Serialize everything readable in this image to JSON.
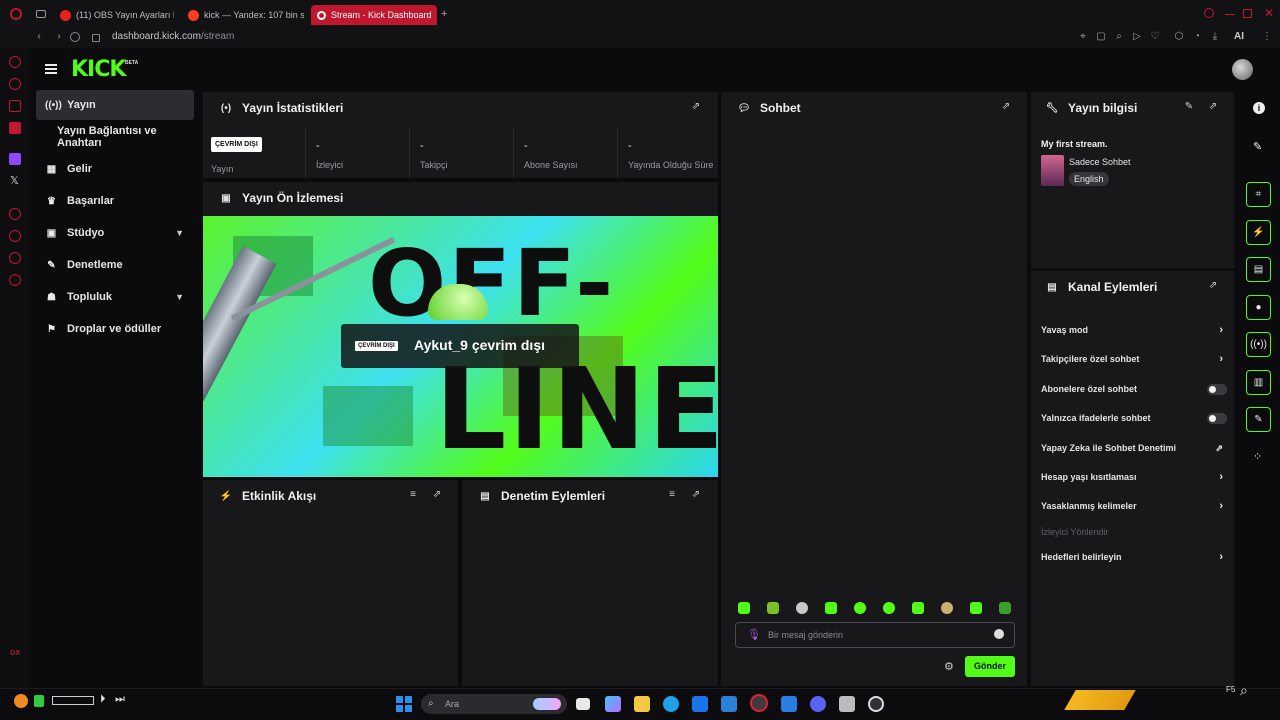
{
  "browser": {
    "tabs": [
      {
        "label": "(11) OBS Yayın Ayarları Nas",
        "color": "#e62117",
        "active": false
      },
      {
        "label": "kick — Yandex: 107 bin so",
        "color": "#fc3f1d",
        "active": false
      },
      {
        "label": "Stream - Kick Dashboard",
        "color": "#ff4d5e",
        "active": true
      }
    ],
    "url_domain": "dashboard.kick.com",
    "url_path": "/stream",
    "ai_label": "AI"
  },
  "header": {
    "logo": "KICK",
    "beta": "BETA"
  },
  "sidebar": {
    "items": [
      {
        "label": "Yayın",
        "icon": "broadcast-icon",
        "active": true
      },
      {
        "label": "Yayın Bağlantısı ve Anahtarı",
        "icon": "",
        "active": false
      },
      {
        "label": "Gelir",
        "icon": "revenue-icon",
        "active": false
      },
      {
        "label": "Başarılar",
        "icon": "trophy-icon",
        "active": false
      },
      {
        "label": "Stüdyo",
        "icon": "studio-icon",
        "active": false,
        "expandable": true
      },
      {
        "label": "Denetleme",
        "icon": "wrench-icon",
        "active": false
      },
      {
        "label": "Topluluk",
        "icon": "community-icon",
        "active": false,
        "expandable": true
      },
      {
        "label": "Droplar ve ödüller",
        "icon": "drops-icon",
        "active": false
      }
    ]
  },
  "stats": {
    "title": "Yayın İstatistikleri",
    "offline_badge": "ÇEVRİM DIŞI",
    "stream_label": "Yayın",
    "items": [
      {
        "value": "-",
        "label": "İzleyici"
      },
      {
        "value": "-",
        "label": "Takipçi"
      },
      {
        "value": "-",
        "label": "Abone Sayısı"
      },
      {
        "value": "-",
        "label": "Yayında Olduğu Süre"
      }
    ]
  },
  "preview": {
    "title": "Yayın Ön İzlemesi",
    "badge": "ÇEVRİM DIŞI",
    "message": "Aykut_9 çevrim dışı",
    "art_text_top": "OFF-",
    "art_text_bottom": "LINE"
  },
  "activity": {
    "title": "Etkinlik Akışı"
  },
  "mod_actions": {
    "title": "Denetim Eylemleri"
  },
  "chat": {
    "title": "Sohbet",
    "placeholder": "Bir mesaj gönderin",
    "send_label": "Gönder"
  },
  "stream_info": {
    "title": "Yayın bilgisi",
    "stream_title": "My first stream.",
    "category": "Sadece Sohbet",
    "language": "English"
  },
  "channel_actions": {
    "title": "Kanal Eylemleri",
    "items": [
      {
        "label": "Yavaş mod",
        "control": "arrow"
      },
      {
        "label": "Takipçilere özel sohbet",
        "control": "arrow"
      },
      {
        "label": "Abonelere özel sohbet",
        "control": "toggle"
      },
      {
        "label": "Yalnızca ifadelerle sohbet",
        "control": "toggle"
      },
      {
        "label": "Yapay Zeka ile Sohbet Denetimi",
        "control": "external"
      },
      {
        "label": "Hesap yaşı kısıtlaması",
        "control": "arrow"
      },
      {
        "label": "Yasaklanmış kelimeler",
        "control": "arrow"
      },
      {
        "label": "İzleyici Yönlendir",
        "control": "disabled"
      },
      {
        "label": "Hedefleri belirleyin",
        "control": "arrow"
      }
    ]
  },
  "taskbar": {
    "search_placeholder": "Ara"
  },
  "colors": {
    "accent": "#53fc18",
    "panel": "#18181b",
    "active_tab": "#c0172f"
  }
}
